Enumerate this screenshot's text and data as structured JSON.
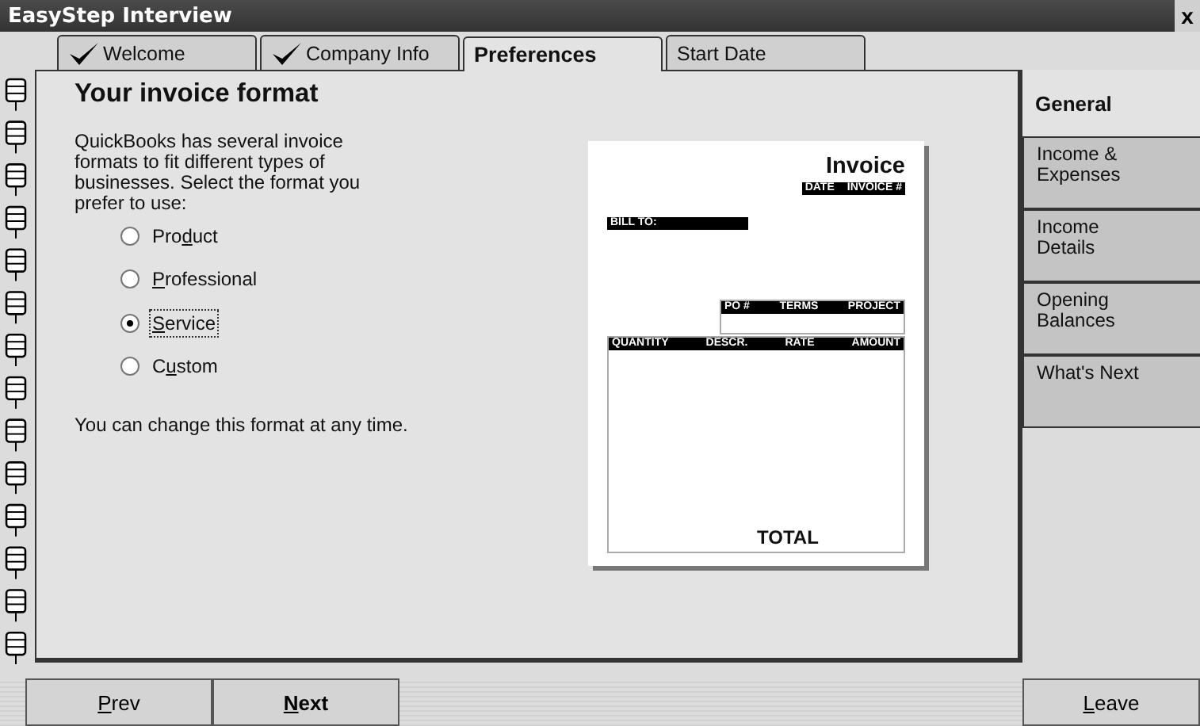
{
  "window": {
    "title": "EasyStep Interview",
    "close": "x"
  },
  "tabs": [
    {
      "label": "Welcome",
      "done": true,
      "selected": false
    },
    {
      "label": "Company Info",
      "done": true,
      "selected": false
    },
    {
      "label": "Preferences",
      "done": false,
      "selected": true
    },
    {
      "label": "Start Date",
      "done": false,
      "selected": false
    }
  ],
  "page": {
    "heading": "Your invoice format",
    "intro": "QuickBooks has several invoice formats to fit different types of businesses.  Select the format you prefer to use:",
    "options": [
      {
        "label": {
          "start": "Pro",
          "hotkey": "d",
          "rest": "uct"
        },
        "selected": false,
        "focused": false
      },
      {
        "label": {
          "hotkey": "P",
          "rest": "rofessional"
        },
        "selected": false,
        "focused": false
      },
      {
        "label": {
          "hotkey": "S",
          "rest": "ervice"
        },
        "selected": true,
        "focused": true
      },
      {
        "label": {
          "start": "C",
          "hotkey": "u",
          "rest": "stom"
        },
        "selected": false,
        "focused": false
      }
    ],
    "note": "You can change this format at any time."
  },
  "invoice_preview": {
    "title": "Invoice",
    "header_labels": [
      "DATE",
      "INVOICE #"
    ],
    "bill_to": "BILL TO:",
    "info_labels": [
      "PO #",
      "TERMS",
      "PROJECT"
    ],
    "columns": [
      "QUANTITY",
      "DESCR.",
      "RATE",
      "AMOUNT"
    ],
    "total": "TOTAL"
  },
  "sections": [
    {
      "label": "General",
      "selected": true
    },
    {
      "label": "Income & Expenses",
      "selected": false
    },
    {
      "label": "Income Details",
      "selected": false
    },
    {
      "label": "Opening Balances",
      "selected": false
    },
    {
      "label": "What's Next",
      "selected": false
    }
  ],
  "buttons": [
    {
      "label": {
        "hotkey": "P",
        "rest": "rev"
      },
      "kind": "nav",
      "bold": false
    },
    {
      "label": {
        "hotkey": "N",
        "rest": "ext"
      },
      "kind": "nav",
      "bold": true
    },
    {
      "label": {
        "hotkey": "L",
        "rest": "eave"
      },
      "kind": "exit",
      "bold": false
    }
  ]
}
